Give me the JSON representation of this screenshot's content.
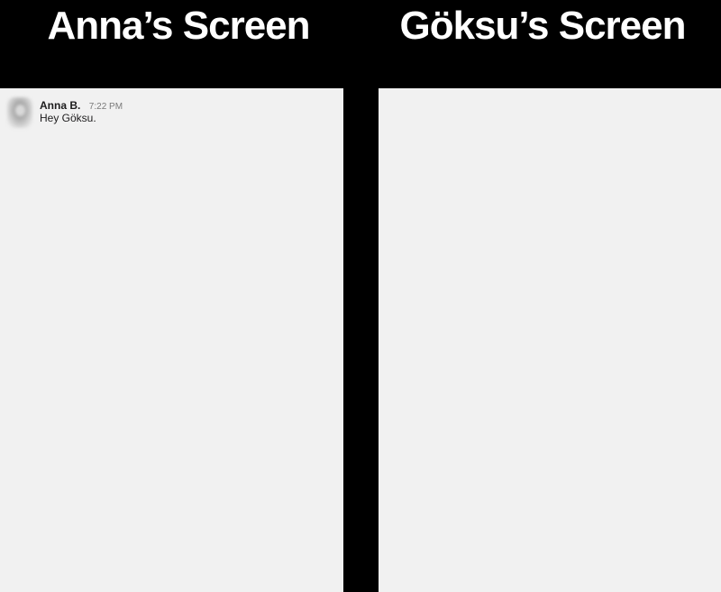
{
  "headers": {
    "left_title": "Anna’s Screen",
    "right_title": "Göksu’s Screen"
  },
  "left_screen": {
    "messages": [
      {
        "author": "Anna B.",
        "time": "7:22 PM",
        "text": "Hey Göksu.",
        "avatar": "avatar-blurred"
      }
    ]
  },
  "right_screen": {
    "messages": []
  },
  "colors": {
    "background": "#000000",
    "panel": "#f1f1f1",
    "title_text": "#ffffff",
    "message_text": "#1d1c1d",
    "timestamp": "#7a7a7a"
  }
}
